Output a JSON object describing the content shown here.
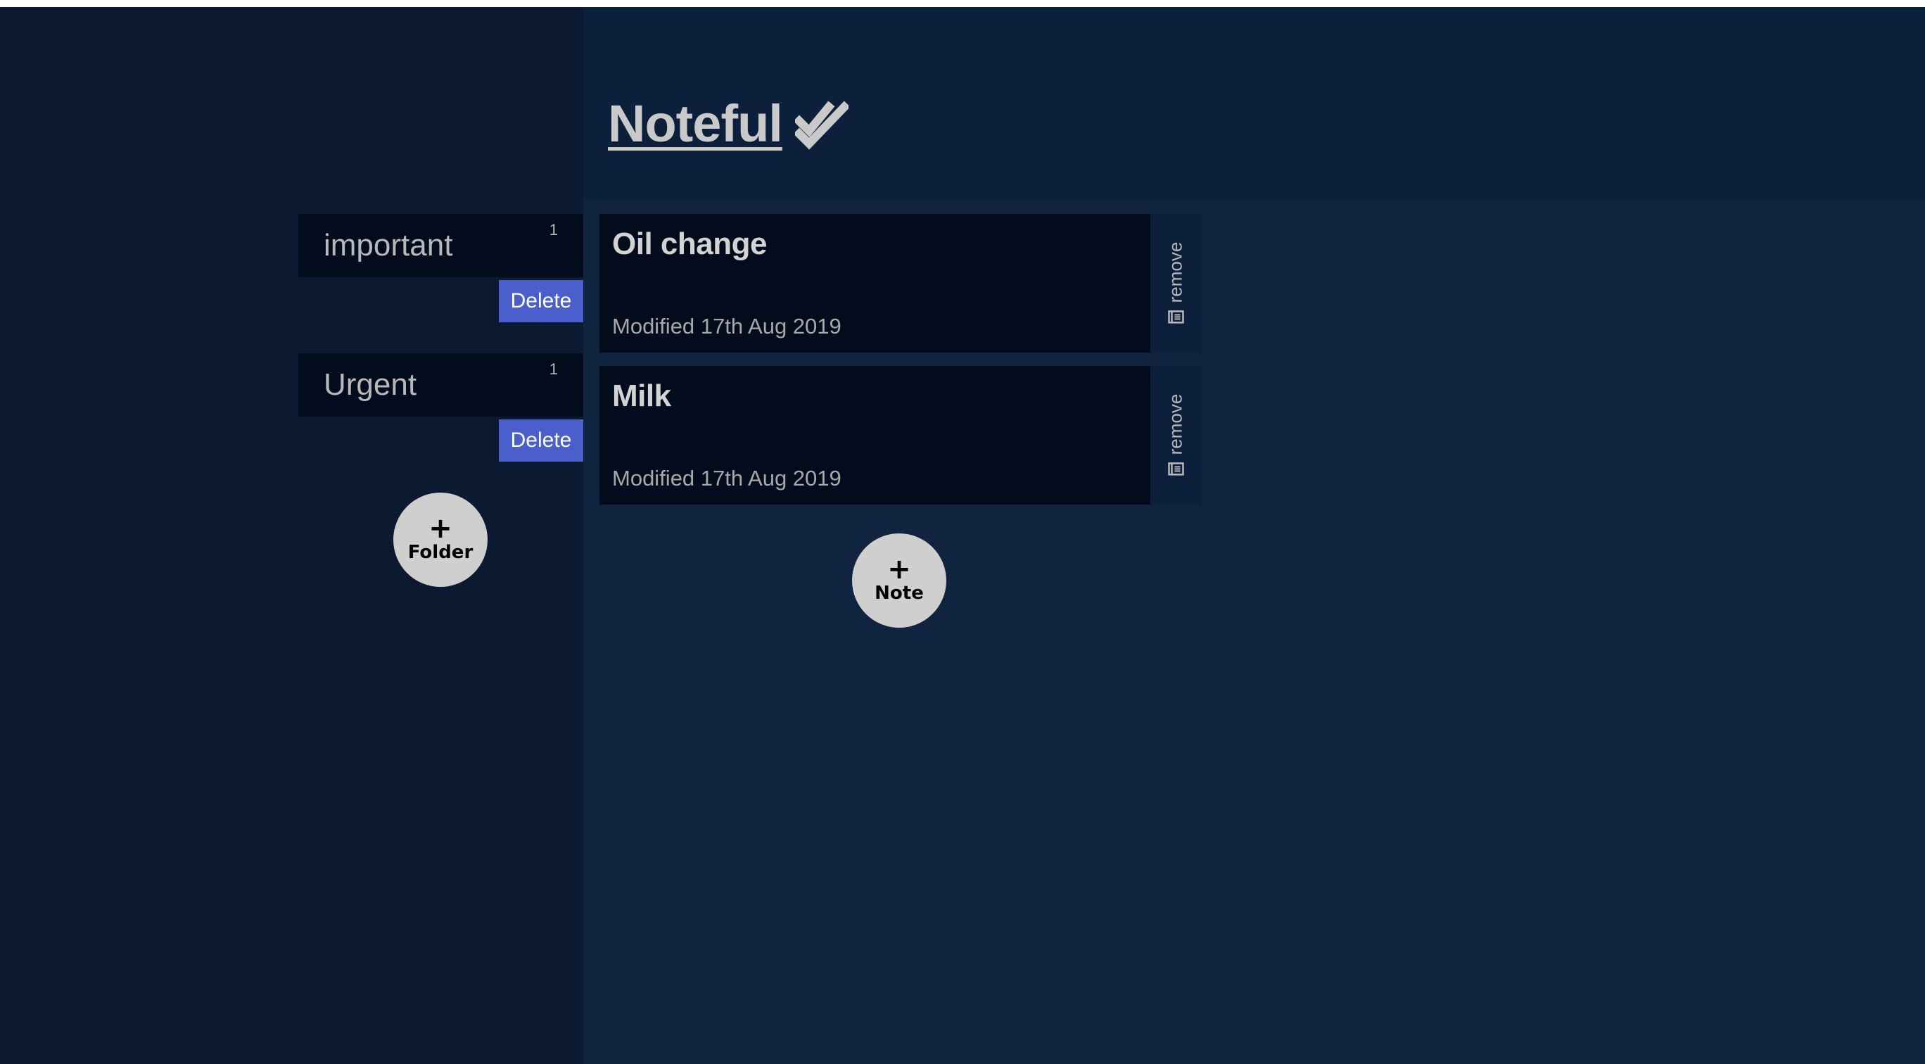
{
  "header": {
    "title": "Noteful",
    "title_icon": "double-check-icon"
  },
  "sidebar": {
    "folders": [
      {
        "name": "important",
        "count": "1",
        "delete_label": "Delete"
      },
      {
        "name": "Urgent",
        "count": "1",
        "delete_label": "Delete"
      }
    ],
    "add_folder": {
      "plus": "+",
      "label": "Folder"
    }
  },
  "main": {
    "notes": [
      {
        "title": "Oil change",
        "modified": "Modified 17th Aug 2019",
        "remove_label": "remove",
        "remove_icon": "trash-icon"
      },
      {
        "title": "Milk",
        "modified": "Modified 17th Aug 2019",
        "remove_label": "remove",
        "remove_icon": "trash-icon"
      }
    ],
    "add_note": {
      "plus": "+",
      "label": "Note"
    }
  },
  "colors": {
    "sidebar_bg": "#0b1a30",
    "header_bg": "#0c1f3b",
    "main_bg": "#10233f",
    "card_bg": "#020c1c",
    "delete_button": "#4a5fcb",
    "round_button": "#cfcfcf"
  }
}
